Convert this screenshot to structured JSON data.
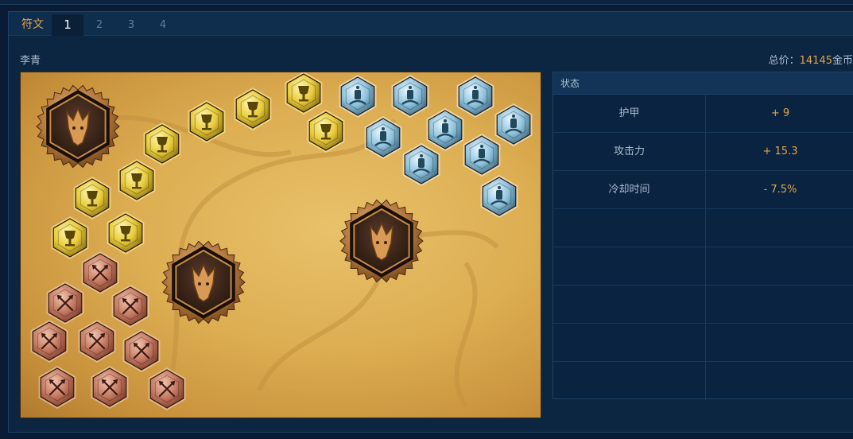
{
  "tabs": {
    "label": "符文",
    "items": [
      "1",
      "2",
      "3",
      "4"
    ],
    "active_index": 0
  },
  "hero": {
    "name": "李青"
  },
  "cost": {
    "label": "总价：",
    "value": "14145",
    "unit": "金币"
  },
  "stats": {
    "header": "状态",
    "rows": [
      {
        "name": "护甲",
        "value": "+ 9"
      },
      {
        "name": "攻击力",
        "value": "+ 15.3"
      },
      {
        "name": "冷却时间",
        "value": "- 7.5%"
      },
      {
        "name": "",
        "value": ""
      },
      {
        "name": "",
        "value": ""
      },
      {
        "name": "",
        "value": ""
      },
      {
        "name": "",
        "value": ""
      },
      {
        "name": "",
        "value": ""
      }
    ]
  },
  "runes": {
    "mark_icon": "crossed-arrows-icon",
    "seal_icon": "chalice-icon",
    "glyph_icon": "lantern-icon",
    "quint_icon": "dragon-head-icon",
    "counts": {
      "marks": 9,
      "seals": 9,
      "glyphs": 9,
      "quintessences": 3
    },
    "colors": {
      "mark": "#b5574a",
      "seal": "#e2c233",
      "glyph": "#7fb3cf",
      "quint": "#3a2418",
      "parchment": "#dcae52"
    }
  }
}
